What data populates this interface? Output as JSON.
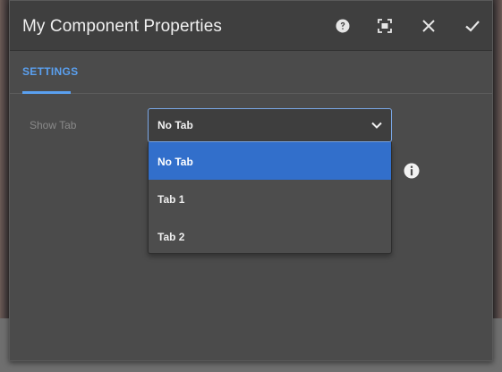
{
  "dialog": {
    "title": "My Component Properties",
    "buttons": {
      "help": "help-icon",
      "fullscreen": "fullscreen-icon",
      "close": "close-icon",
      "done": "checkmark-icon"
    }
  },
  "tabs": [
    {
      "label": "SETTINGS",
      "active": true
    }
  ],
  "form": {
    "show_tab": {
      "label": "Show Tab",
      "value": "No Tab",
      "options": [
        "No Tab",
        "Tab 1",
        "Tab 2"
      ],
      "selected_index": 0
    }
  },
  "colors": {
    "accent": "#5aa0f0",
    "selected_option": "#326fcb",
    "dialog_bg": "#4b4b4b",
    "titlebar_bg": "#3f3f3f"
  }
}
